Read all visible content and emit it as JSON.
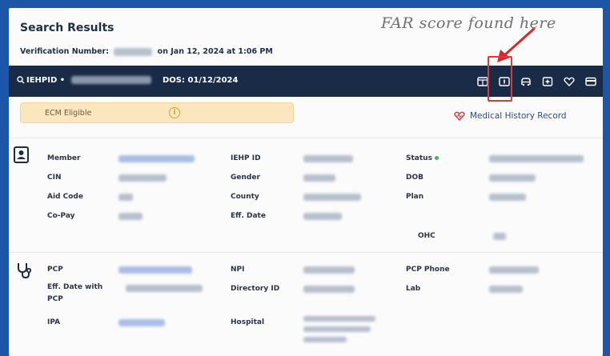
{
  "header": {
    "title": "Search Results",
    "verification_prefix": "Verification Number:",
    "verification_suffix": "on Jan 12, 2024 at 1:06 PM"
  },
  "annotation": "FAR score found here",
  "navbar": {
    "id_label": "IEHPID •",
    "dos": "DOS: 01/12/2024",
    "icons": [
      "id-card-icon",
      "far-score-icon",
      "vehicle-icon",
      "plus-card-icon",
      "heart-icon",
      "credit-card-icon"
    ]
  },
  "banner": {
    "ecm_label": "ECM Eligible",
    "medical_history_link": "Medical History Record"
  },
  "member": {
    "labels": {
      "member": "Member",
      "cin": "CIN",
      "aid_code": "Aid Code",
      "co_pay": "Co-Pay",
      "iehp_id": "IEHP ID",
      "gender": "Gender",
      "county": "County",
      "eff_date": "Eff. Date",
      "status": "Status",
      "dob": "DOB",
      "plan": "Plan",
      "ohc": "OHC"
    }
  },
  "provider": {
    "labels": {
      "pcp": "PCP",
      "eff_date_with_pcp": "Eff. Date with PCP",
      "ipa": "IPA",
      "npi": "NPI",
      "directory_id": "Directory ID",
      "hospital": "Hospital",
      "pcp_phone": "PCP Phone",
      "lab": "Lab"
    }
  },
  "colors": {
    "page_background": "#1c56a8",
    "navbar": "#1a2b48",
    "ecm_banner": "#fbe6bf",
    "highlight": "#d93a3a",
    "status_active": "#2dbd52"
  }
}
